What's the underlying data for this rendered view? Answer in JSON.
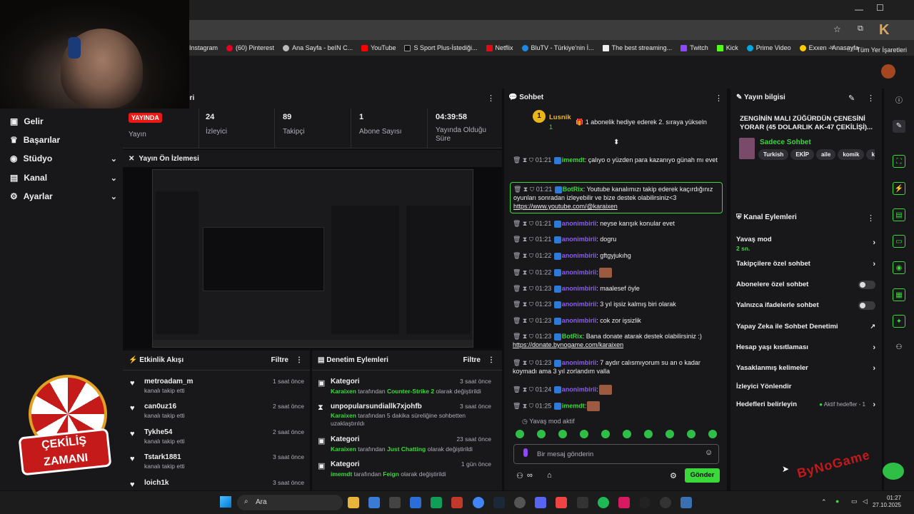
{
  "bookmarks": [
    "Instagram",
    "(60) Pinterest",
    "Ana Sayfa - beIN C...",
    "YouTube",
    "S Sport Plus-İstediği...",
    "Netflix",
    "BluTV - Türkiye'nin İ...",
    "The best streaming...",
    "Twitch",
    "Kick",
    "Prime Video",
    "Exxen - Anasayfa"
  ],
  "bookmarks_all": "Tüm Yer İşaretleri",
  "left_panel_header_tail": "eri",
  "nav": [
    "Gelir",
    "Başarılar",
    "Stüdyo",
    "Kanal",
    "Ayarlar"
  ],
  "stats": {
    "live_label": "YAYINDA",
    "live_sub": "Yayın",
    "viewers": "24",
    "viewers_label": "İzleyici",
    "followers": "89",
    "followers_label": "Takipçi",
    "subs": "1",
    "subs_label": "Abone Sayısı",
    "uptime": "04:39:58",
    "uptime_label": "Yayında Olduğu Süre"
  },
  "preview_title": "Yayın Ön İzlemesi",
  "activity": {
    "title": "Etkinlik Akışı",
    "filter": "Filtre",
    "items": [
      {
        "name": "metroadam_m",
        "sub": "kanalı takip etti",
        "time": "1 saat önce"
      },
      {
        "name": "can0uz16",
        "sub": "kanalı takip etti",
        "time": "2 saat önce"
      },
      {
        "name": "Tykhe54",
        "sub": "kanalı takip etti",
        "time": "2 saat önce"
      },
      {
        "name": "Tstark1881",
        "sub": "kanalı takip etti",
        "time": "3 saat önce"
      },
      {
        "name": "loich1k",
        "sub": "",
        "time": "3 saat önce"
      }
    ]
  },
  "moderation": {
    "title": "Denetim Eylemleri",
    "filter": "Filtre",
    "items": [
      {
        "name": "Kategori",
        "actor": "Karaixen",
        "pre": " tarafından ",
        "target": "Counter-Strike 2",
        "post": " olarak değiştirildi",
        "time": "3 saat önce"
      },
      {
        "name": "unpopularsundiallk7xjohfb",
        "actor": "Karaixen",
        "pre": " tarafından 5 dakika süreliğine sohbetten uzaklaştırıldı",
        "target": "",
        "post": "",
        "time": "3 saat önce"
      },
      {
        "name": "Kategori",
        "actor": "Karaixen",
        "pre": " tarafından ",
        "target": "Just Chatting",
        "post": " olarak değiştirildi",
        "time": "23 saat önce"
      },
      {
        "name": "Kategori",
        "actor": "imemdt",
        "pre": " tarafından ",
        "target": "Feign",
        "post": " olarak değiştirildi",
        "time": "1 gün önce"
      }
    ]
  },
  "chat": {
    "title": "Sohbet",
    "top_user": "Lusnik",
    "top_count": "1",
    "gift_text": "1 abonelik hediye ederek 2. sıraya yükseln",
    "messages": [
      {
        "time": "01:21",
        "user": "imemdt",
        "text": ": çalıyo o yüzden para kazanıyo günah mı evet",
        "color": "#3ad83a"
      },
      {
        "time": "01:21",
        "user": "BotRix",
        "text": ": Youtube kanalımızı takip ederek kaçırdığınız oyunları sonradan izleyebilir ve bize destek olabilirsiniz<3 ",
        "link": "https://www.youtube.com/@karaixen",
        "color": "#3ad83a"
      },
      {
        "time": "01:21",
        "user": "anonimbirii",
        "text": ": neyse karışık konular evet",
        "color": "#8a5cf6"
      },
      {
        "time": "01:21",
        "user": "anonimbirii",
        "text": ": dogru",
        "color": "#8a5cf6"
      },
      {
        "time": "01:22",
        "user": "anonimbirii",
        "text": ": gftgyjukıhg",
        "color": "#8a5cf6"
      },
      {
        "time": "01:22",
        "user": "anonimbirii",
        "text": ":",
        "color": "#8a5cf6"
      },
      {
        "time": "01:23",
        "user": "anonimbirii",
        "text": ": maalesef öyle",
        "color": "#8a5cf6"
      },
      {
        "time": "01:23",
        "user": "anonimbirii",
        "text": ": 3 yıl işsiz kalmış biri olarak",
        "color": "#8a5cf6"
      },
      {
        "time": "01:23",
        "user": "anonimbirii",
        "text": ": cok zor işsizlik",
        "color": "#8a5cf6"
      },
      {
        "time": "01:23",
        "user": "BotRix",
        "text": ": Bana donate atarak destek olabilirsiniz :) ",
        "link": "https://donate.bynogame.com/karaixen",
        "color": "#3ad83a"
      },
      {
        "time": "01:23",
        "user": "anonimbirii",
        "text": ": 7 aydır calısmıyorum su an o kadar koymadı ama 3 yıl zorlandım valla",
        "color": "#8a5cf6"
      },
      {
        "time": "01:24",
        "user": "anonimbirii",
        "text": ":",
        "color": "#8a5cf6"
      },
      {
        "time": "01:25",
        "user": "imemdt",
        "text": ":",
        "color": "#3ad83a"
      }
    ],
    "slow_mode": "Yavaş mod aktif",
    "input_placeholder": "Bir mesaj gönderin",
    "send": "Gönder"
  },
  "stream_info": {
    "title": "Yayın bilgisi",
    "stream_title": "ZENGİNİN MALI ZÜĞÜRDÜN ÇENESİNİ YORAR (45 DOLARLIK AK-47 ÇEKİLİŞİ)...",
    "category": "Sadece Sohbet",
    "tags": [
      "Turkish",
      "EKİP",
      "aile",
      "komik",
      "ko"
    ]
  },
  "channel_actions": {
    "title": "Kanal Eylemleri",
    "slow_mode": "Yavaş mod",
    "slow_mode_value": "2 sn.",
    "followers_only": "Takipçilere özel sohbet",
    "subs_only": "Abonelere özel sohbet",
    "emote_only": "Yalnızca ifadelerle sohbet",
    "ai_mod": "Yapay Zeka ile Sohbet Denetimi",
    "age_limit": "Hesap yaşı kısıtlaması",
    "banned_words": "Yasaklanmış kelimeler",
    "viewer_redirect": "İzleyici Yönlendir",
    "set_goals": "Hedefleri belirleyin",
    "active_goals": "Aktif hedefler - 1"
  },
  "giveaway": {
    "line1": "ÇEKİLİŞ",
    "line2": "ZAMANI"
  },
  "watermark": "ByNoGame",
  "taskbar": {
    "search": "Ara",
    "time": "01:27",
    "date": "27.10.2025"
  },
  "colors": {
    "accent": "#3ad83a",
    "live": "#e91916",
    "bg": "#0e0e10",
    "panel": "#18181b"
  }
}
